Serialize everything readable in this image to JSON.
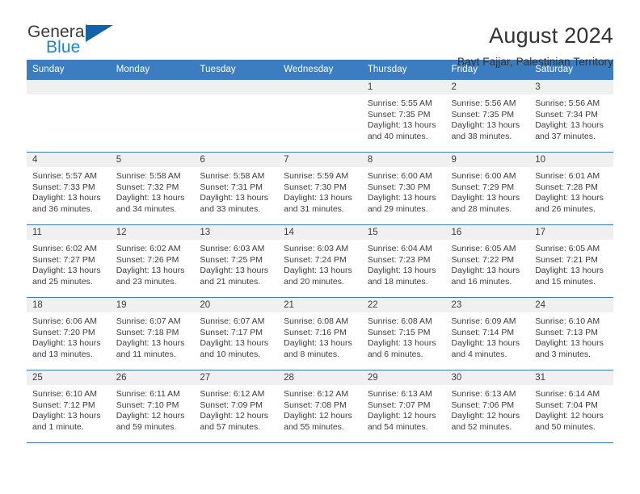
{
  "brand": {
    "name_top": "General",
    "name_bottom": "Blue",
    "accent_color": "#1787d8",
    "triangle_color": "#1162a8"
  },
  "header": {
    "title": "August 2024",
    "subtitle": "Bayt Fajjar, Palestinian Territory"
  },
  "calendar": {
    "header_bg": "#3b7dc0",
    "daynum_bg": "#f0f0f0",
    "weekdays": [
      "Sunday",
      "Monday",
      "Tuesday",
      "Wednesday",
      "Thursday",
      "Friday",
      "Saturday"
    ],
    "weeks": [
      [
        {
          "day": "",
          "empty": true
        },
        {
          "day": "",
          "empty": true
        },
        {
          "day": "",
          "empty": true
        },
        {
          "day": "",
          "empty": true
        },
        {
          "day": "1",
          "sunrise": "Sunrise: 5:55 AM",
          "sunset": "Sunset: 7:35 PM",
          "daylight": "Daylight: 13 hours and 40 minutes."
        },
        {
          "day": "2",
          "sunrise": "Sunrise: 5:56 AM",
          "sunset": "Sunset: 7:35 PM",
          "daylight": "Daylight: 13 hours and 38 minutes."
        },
        {
          "day": "3",
          "sunrise": "Sunrise: 5:56 AM",
          "sunset": "Sunset: 7:34 PM",
          "daylight": "Daylight: 13 hours and 37 minutes."
        }
      ],
      [
        {
          "day": "4",
          "sunrise": "Sunrise: 5:57 AM",
          "sunset": "Sunset: 7:33 PM",
          "daylight": "Daylight: 13 hours and 36 minutes."
        },
        {
          "day": "5",
          "sunrise": "Sunrise: 5:58 AM",
          "sunset": "Sunset: 7:32 PM",
          "daylight": "Daylight: 13 hours and 34 minutes."
        },
        {
          "day": "6",
          "sunrise": "Sunrise: 5:58 AM",
          "sunset": "Sunset: 7:31 PM",
          "daylight": "Daylight: 13 hours and 33 minutes."
        },
        {
          "day": "7",
          "sunrise": "Sunrise: 5:59 AM",
          "sunset": "Sunset: 7:30 PM",
          "daylight": "Daylight: 13 hours and 31 minutes."
        },
        {
          "day": "8",
          "sunrise": "Sunrise: 6:00 AM",
          "sunset": "Sunset: 7:30 PM",
          "daylight": "Daylight: 13 hours and 29 minutes."
        },
        {
          "day": "9",
          "sunrise": "Sunrise: 6:00 AM",
          "sunset": "Sunset: 7:29 PM",
          "daylight": "Daylight: 13 hours and 28 minutes."
        },
        {
          "day": "10",
          "sunrise": "Sunrise: 6:01 AM",
          "sunset": "Sunset: 7:28 PM",
          "daylight": "Daylight: 13 hours and 26 minutes."
        }
      ],
      [
        {
          "day": "11",
          "sunrise": "Sunrise: 6:02 AM",
          "sunset": "Sunset: 7:27 PM",
          "daylight": "Daylight: 13 hours and 25 minutes."
        },
        {
          "day": "12",
          "sunrise": "Sunrise: 6:02 AM",
          "sunset": "Sunset: 7:26 PM",
          "daylight": "Daylight: 13 hours and 23 minutes."
        },
        {
          "day": "13",
          "sunrise": "Sunrise: 6:03 AM",
          "sunset": "Sunset: 7:25 PM",
          "daylight": "Daylight: 13 hours and 21 minutes."
        },
        {
          "day": "14",
          "sunrise": "Sunrise: 6:03 AM",
          "sunset": "Sunset: 7:24 PM",
          "daylight": "Daylight: 13 hours and 20 minutes."
        },
        {
          "day": "15",
          "sunrise": "Sunrise: 6:04 AM",
          "sunset": "Sunset: 7:23 PM",
          "daylight": "Daylight: 13 hours and 18 minutes."
        },
        {
          "day": "16",
          "sunrise": "Sunrise: 6:05 AM",
          "sunset": "Sunset: 7:22 PM",
          "daylight": "Daylight: 13 hours and 16 minutes."
        },
        {
          "day": "17",
          "sunrise": "Sunrise: 6:05 AM",
          "sunset": "Sunset: 7:21 PM",
          "daylight": "Daylight: 13 hours and 15 minutes."
        }
      ],
      [
        {
          "day": "18",
          "sunrise": "Sunrise: 6:06 AM",
          "sunset": "Sunset: 7:20 PM",
          "daylight": "Daylight: 13 hours and 13 minutes."
        },
        {
          "day": "19",
          "sunrise": "Sunrise: 6:07 AM",
          "sunset": "Sunset: 7:18 PM",
          "daylight": "Daylight: 13 hours and 11 minutes."
        },
        {
          "day": "20",
          "sunrise": "Sunrise: 6:07 AM",
          "sunset": "Sunset: 7:17 PM",
          "daylight": "Daylight: 13 hours and 10 minutes."
        },
        {
          "day": "21",
          "sunrise": "Sunrise: 6:08 AM",
          "sunset": "Sunset: 7:16 PM",
          "daylight": "Daylight: 13 hours and 8 minutes."
        },
        {
          "day": "22",
          "sunrise": "Sunrise: 6:08 AM",
          "sunset": "Sunset: 7:15 PM",
          "daylight": "Daylight: 13 hours and 6 minutes."
        },
        {
          "day": "23",
          "sunrise": "Sunrise: 6:09 AM",
          "sunset": "Sunset: 7:14 PM",
          "daylight": "Daylight: 13 hours and 4 minutes."
        },
        {
          "day": "24",
          "sunrise": "Sunrise: 6:10 AM",
          "sunset": "Sunset: 7:13 PM",
          "daylight": "Daylight: 13 hours and 3 minutes."
        }
      ],
      [
        {
          "day": "25",
          "sunrise": "Sunrise: 6:10 AM",
          "sunset": "Sunset: 7:12 PM",
          "daylight": "Daylight: 13 hours and 1 minute."
        },
        {
          "day": "26",
          "sunrise": "Sunrise: 6:11 AM",
          "sunset": "Sunset: 7:10 PM",
          "daylight": "Daylight: 12 hours and 59 minutes."
        },
        {
          "day": "27",
          "sunrise": "Sunrise: 6:12 AM",
          "sunset": "Sunset: 7:09 PM",
          "daylight": "Daylight: 12 hours and 57 minutes."
        },
        {
          "day": "28",
          "sunrise": "Sunrise: 6:12 AM",
          "sunset": "Sunset: 7:08 PM",
          "daylight": "Daylight: 12 hours and 55 minutes."
        },
        {
          "day": "29",
          "sunrise": "Sunrise: 6:13 AM",
          "sunset": "Sunset: 7:07 PM",
          "daylight": "Daylight: 12 hours and 54 minutes."
        },
        {
          "day": "30",
          "sunrise": "Sunrise: 6:13 AM",
          "sunset": "Sunset: 7:06 PM",
          "daylight": "Daylight: 12 hours and 52 minutes."
        },
        {
          "day": "31",
          "sunrise": "Sunrise: 6:14 AM",
          "sunset": "Sunset: 7:04 PM",
          "daylight": "Daylight: 12 hours and 50 minutes."
        }
      ]
    ]
  }
}
